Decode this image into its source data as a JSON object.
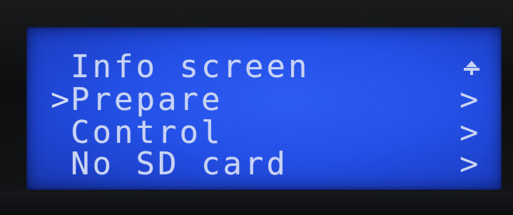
{
  "menu": {
    "items": [
      {
        "label": "Info screen",
        "indicator": "up-arrow"
      },
      {
        "label": "Prepare",
        "indicator": "submenu-arrow",
        "selected": true
      },
      {
        "label": "Control",
        "indicator": "submenu-arrow"
      },
      {
        "label": "No SD card",
        "indicator": "submenu-arrow"
      }
    ],
    "cursor_glyph": ">",
    "submenu_glyph": ">"
  },
  "colors": {
    "lcd_background": "#2450e6",
    "lcd_text": "#c9d3f4",
    "bezel": "#0d0e10"
  }
}
